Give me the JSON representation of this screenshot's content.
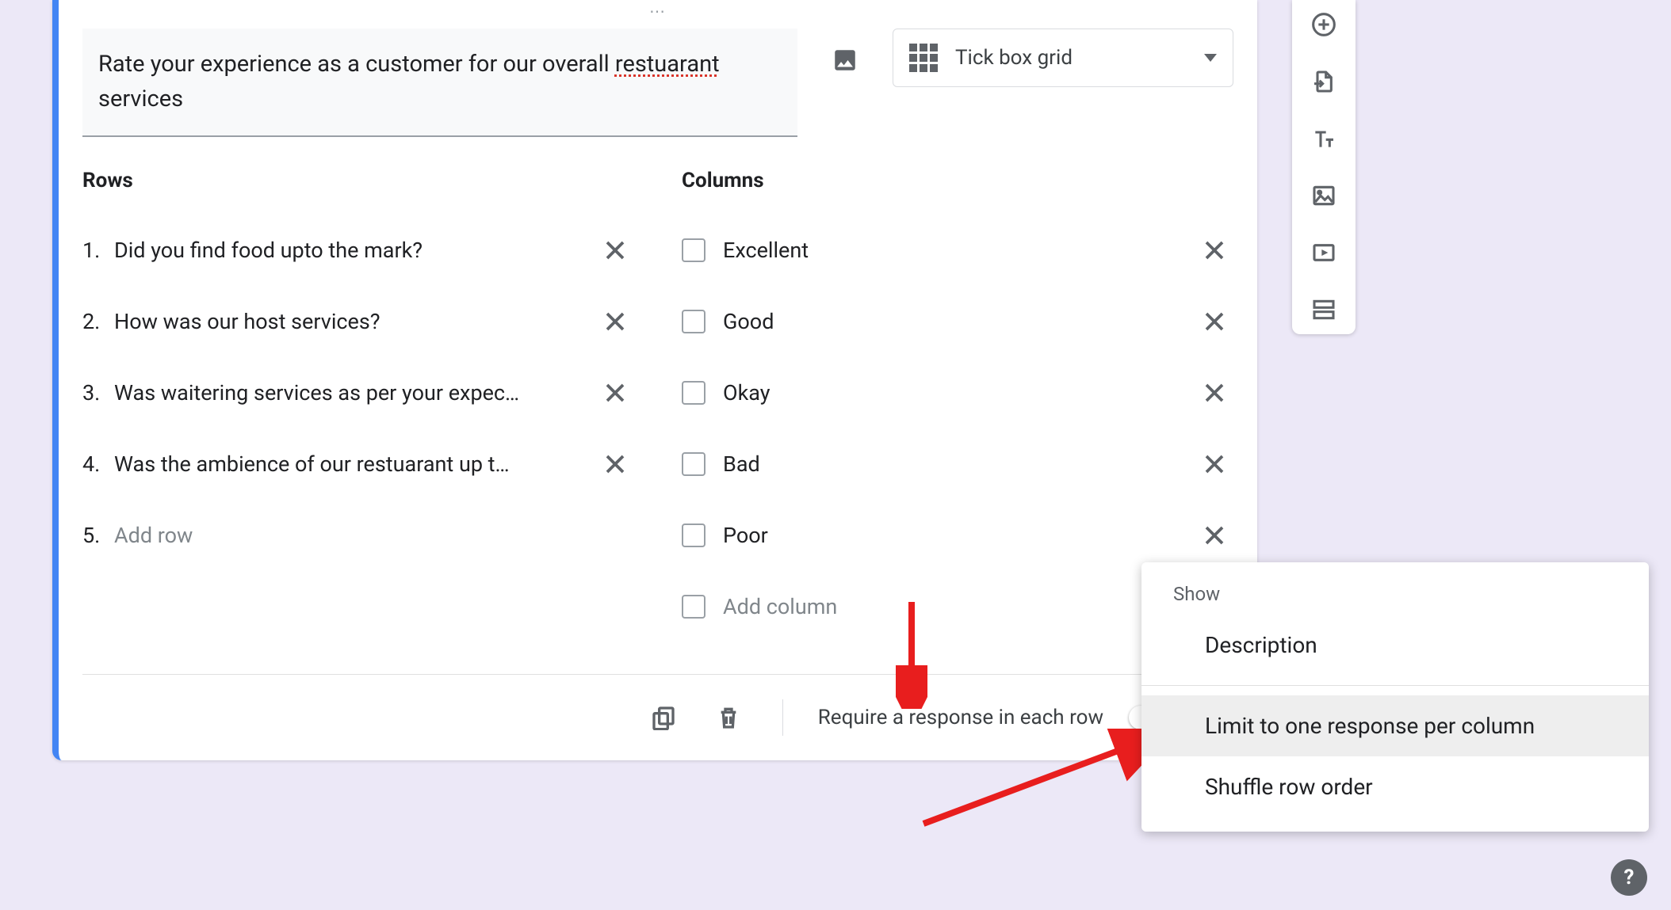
{
  "question_text_pre": "Rate your experience as a customer for our overall ",
  "question_text_miss": "restuarant",
  "question_text_post": " services",
  "question_type": "Tick box grid",
  "rows_header": "Rows",
  "columns_header": "Columns",
  "rows": [
    {
      "n": "1.",
      "text": "Did you find food upto the mark?"
    },
    {
      "n": "2.",
      "text": "How was our host services?"
    },
    {
      "n": "3.",
      "text": "Was waitering services as per your expec…"
    },
    {
      "n": "4.",
      "text": "Was the ambience of our restuarant up t…"
    }
  ],
  "add_row_n": "5.",
  "add_row_placeholder": "Add row",
  "columns": [
    "Excellent",
    "Good",
    "Okay",
    "Bad",
    "Poor"
  ],
  "add_column_placeholder": "Add column",
  "require_label": "Require a response in each row",
  "context_menu": {
    "header": "Show",
    "description": "Description",
    "limit": "Limit to one response per column",
    "shuffle": "Shuffle row order"
  },
  "help": "?"
}
